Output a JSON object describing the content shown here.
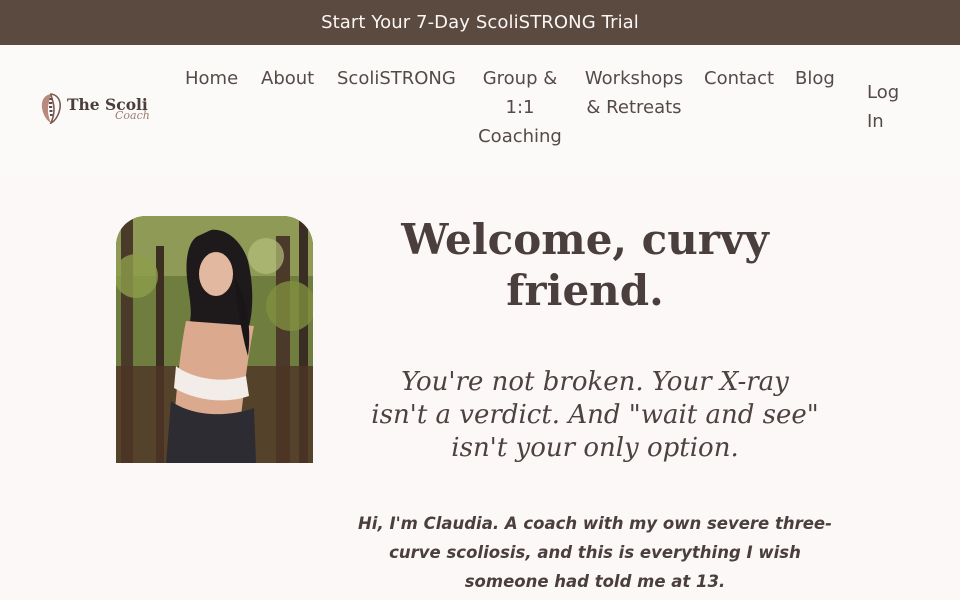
{
  "promo": {
    "text": "Start Your 7-Day ScoliSTRONG Trial"
  },
  "logo": {
    "main": "The Scoli",
    "script": "Coach"
  },
  "nav": {
    "home": "Home",
    "about": "About",
    "scolistrong": "ScoliSTRONG",
    "coaching_line1": "Group &",
    "coaching_line2": "1:1",
    "coaching_line3": "Coaching",
    "workshops_line1": "Workshops",
    "workshops_line2": "& Retreats",
    "contact": "Contact",
    "blog": "Blog",
    "login_line1": "Log",
    "login_line2": "In"
  },
  "hero": {
    "headline_line1": "Welcome, curvy",
    "headline_line2": "friend.",
    "subhead_line1": "You're not broken. Your X-ray",
    "subhead_line2": "isn't a verdict. And \"wait and see\"",
    "subhead_line3": "isn't your only option.",
    "intro_line1": "Hi, I'm Claudia. A coach with my own severe three-",
    "intro_line2": "curve scoliosis, and this is everything I wish",
    "intro_line3": "someone had told me at 13."
  },
  "colors": {
    "promo_bg": "#5a4a40",
    "page_bg": "#fcf9f8",
    "text": "#4a3f3d"
  }
}
